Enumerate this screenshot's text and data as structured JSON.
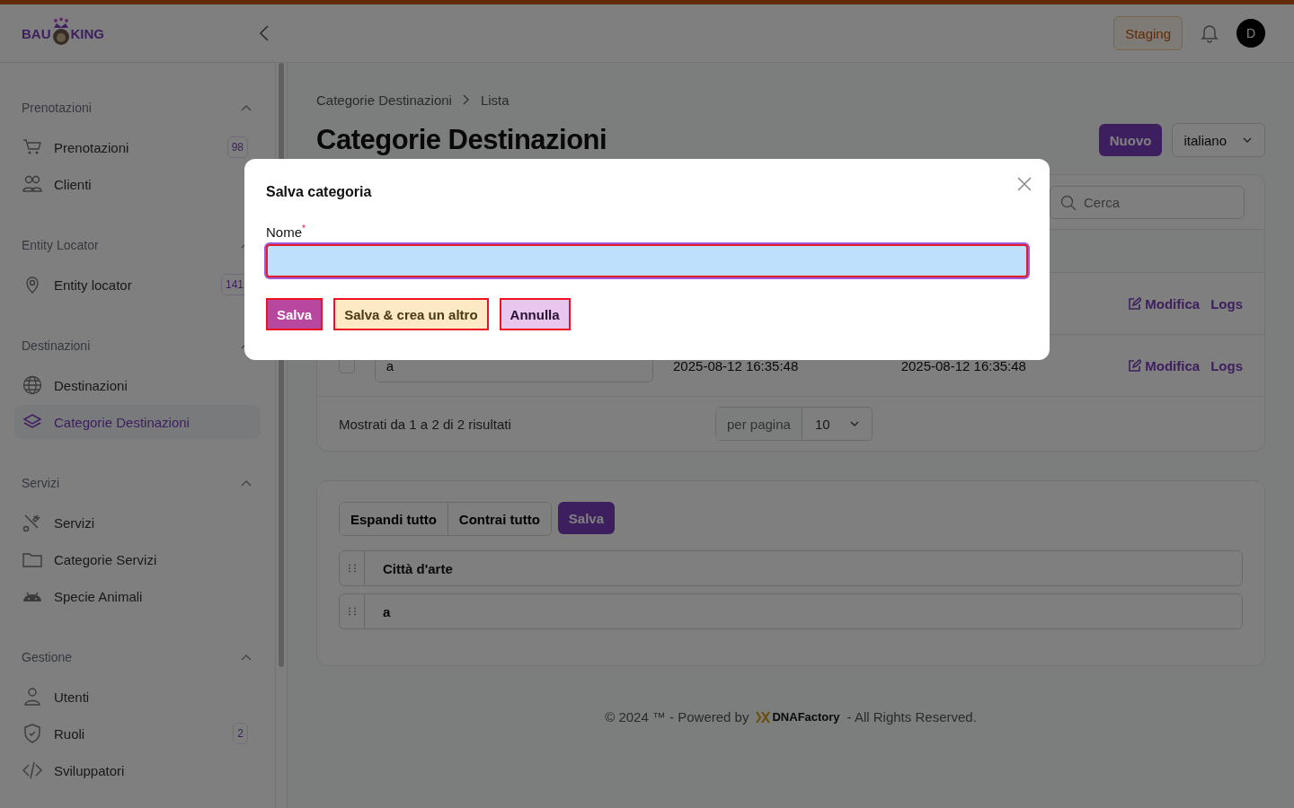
{
  "topbar": {
    "logo": {
      "left": "BAU",
      "right": "KING"
    },
    "environment": "Staging",
    "avatar": "D"
  },
  "sidebar": {
    "sections": [
      {
        "title": "Prenotazioni",
        "expanded": true,
        "items": [
          {
            "label": "Prenotazioni",
            "badge": "98",
            "selected": false
          },
          {
            "label": "Clienti",
            "selected": false
          }
        ]
      },
      {
        "title": "Entity Locator",
        "expanded": true,
        "items": [
          {
            "label": "Entity locator",
            "badge": "141",
            "selected": false
          }
        ]
      },
      {
        "title": "Destinazioni",
        "expanded": true,
        "items": [
          {
            "label": "Destinazioni",
            "selected": false
          },
          {
            "label": "Categorie Destinazioni",
            "selected": true
          }
        ]
      },
      {
        "title": "Servizi",
        "expanded": true,
        "items": [
          {
            "label": "Servizi",
            "selected": false
          },
          {
            "label": "Categorie Servizi",
            "selected": false
          },
          {
            "label": "Specie Animali",
            "selected": false
          }
        ]
      },
      {
        "title": "Gestione",
        "expanded": true,
        "items": [
          {
            "label": "Utenti",
            "selected": false
          },
          {
            "label": "Ruoli",
            "badge": "2",
            "selected": false
          },
          {
            "label": "Sviluppatori",
            "selected": false
          }
        ]
      }
    ]
  },
  "breadcrumb": [
    "Categorie Destinazioni",
    "Lista"
  ],
  "page_title": "Categorie Destinazioni",
  "new_button": "Nuovo",
  "language": "italiano",
  "table": {
    "search": {
      "placeholder": "Cerca"
    },
    "rows": [
      {
        "name": null,
        "created": null,
        "updated": null,
        "edit": "Modifica",
        "logs": "Logs"
      },
      {
        "name": "a",
        "created": "2025-08-12 16:35:48",
        "updated": "2025-08-12 16:35:48",
        "edit": "Modifica",
        "logs": "Logs",
        "checked": false
      }
    ],
    "summary": "Mostrati da 1 a 2 di 2 risultati",
    "per_page_label": "per pagina",
    "per_page": "10"
  },
  "tree": {
    "buttons": [
      "Espandi tutto",
      "Contrai tutto"
    ],
    "save": "Salva",
    "items": [
      "Città d'arte",
      "a"
    ]
  },
  "footer": {
    "before": "© 2024 ™ - Powered by",
    "brand": "DNAFactory",
    "after": "- All Rights Reserved."
  },
  "modal": {
    "title": "Salva categoria",
    "field": {
      "label": "Nome",
      "required": true,
      "required_mark": "*"
    },
    "buttons": [
      {
        "label": "Salva",
        "kind": "primary"
      },
      {
        "label": "Salva & crea un altro",
        "kind": "secondary"
      },
      {
        "label": "Annulla",
        "kind": "cancel"
      }
    ]
  }
}
